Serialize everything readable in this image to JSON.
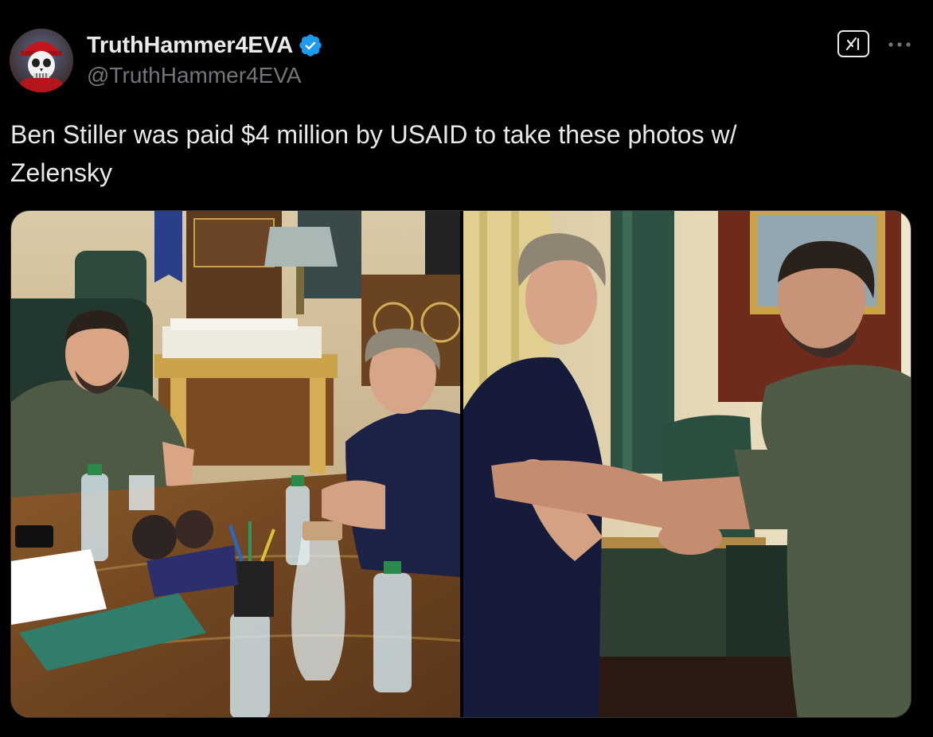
{
  "author": {
    "display_name": "TruthHammer4EVA",
    "handle": "@TruthHammer4EVA",
    "verified": true,
    "avatar_icon": "punisher-skull-avatar"
  },
  "actions": {
    "grok_icon": "grok-icon",
    "more_icon": "more-options-icon"
  },
  "post": {
    "text_line1": "Ben Stiller was paid $4 million by USAID to take these photos w/",
    "text_line2": "Zelensky"
  },
  "media": {
    "photos": [
      {
        "name": "photo-meeting-at-desk"
      },
      {
        "name": "photo-handshake"
      }
    ]
  },
  "colors": {
    "background": "#000000",
    "text_primary": "#e7e9ea",
    "text_secondary": "#71767b",
    "verified_blue": "#1d9bf0",
    "border": "#2f3336"
  }
}
